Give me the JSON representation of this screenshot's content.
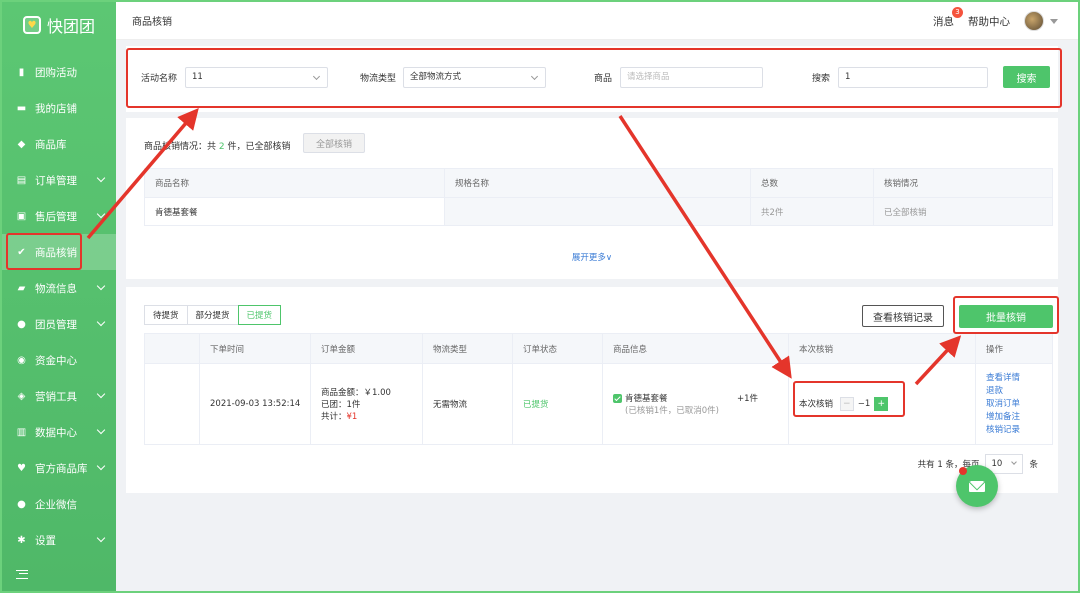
{
  "app": {
    "name": "快团团"
  },
  "sidebar": {
    "items": [
      {
        "label": "团购活动",
        "icon": "bookmark-icon",
        "expandable": false
      },
      {
        "label": "我的店铺",
        "icon": "store-icon",
        "expandable": false
      },
      {
        "label": "商品库",
        "icon": "box-icon",
        "expandable": false
      },
      {
        "label": "订单管理",
        "icon": "order-icon",
        "expandable": true
      },
      {
        "label": "售后管理",
        "icon": "aftersale-icon",
        "expandable": true
      },
      {
        "label": "商品核销",
        "icon": "bag-check-icon",
        "expandable": false,
        "active": true
      },
      {
        "label": "物流信息",
        "icon": "truck-icon",
        "expandable": true
      },
      {
        "label": "团员管理",
        "icon": "user-icon",
        "expandable": true
      },
      {
        "label": "资金中心",
        "icon": "money-icon",
        "expandable": false
      },
      {
        "label": "营销工具",
        "icon": "tag-icon",
        "expandable": true
      },
      {
        "label": "数据中心",
        "icon": "chart-icon",
        "expandable": true
      },
      {
        "label": "官方商品库",
        "icon": "heart-icon",
        "expandable": true
      },
      {
        "label": "企业微信",
        "icon": "wechat-icon",
        "expandable": false
      },
      {
        "label": "设置",
        "icon": "gear-icon",
        "expandable": true
      }
    ]
  },
  "topbar": {
    "breadcrumb": "商品核销",
    "messages_label": "消息",
    "messages_count": "3",
    "help_label": "帮助中心"
  },
  "search": {
    "activity_label": "活动名称",
    "activity_value": "11",
    "logistics_label": "物流类型",
    "logistics_value": "全部物流方式",
    "product_label": "商品",
    "product_placeholder": "请选择商品",
    "keyword_label": "搜索",
    "keyword_value": "1",
    "search_button": "搜索"
  },
  "summary": {
    "text_prefix": "商品核销情况：共",
    "count": "2",
    "text_suffix": "件，已全部核销",
    "all_button": "全部核销",
    "columns": [
      "商品名称",
      "规格名称",
      "总数",
      "核销情况"
    ],
    "rows": [
      {
        "name": "肯德基套餐",
        "spec": "",
        "total": "共2件",
        "status": "已全部核销"
      }
    ],
    "expand_label": "展开更多∨"
  },
  "orders": {
    "tabs": [
      {
        "label": "待提货",
        "active": false
      },
      {
        "label": "部分提货",
        "active": false
      },
      {
        "label": "已提货",
        "active": true
      }
    ],
    "records_button": "查看核销记录",
    "batch_button": "批量核销",
    "columns": [
      "",
      "下单时间",
      "订单金额",
      "物流类型",
      "订单状态",
      "商品信息",
      "本次核销",
      "操作"
    ],
    "row": {
      "time": "2021-09-03 13:52:14",
      "amount_line1": "商品金额：￥1.00",
      "amount_line2": "已团：1件",
      "amount_total_label": "共计：",
      "amount_total_value": "¥1",
      "logistics": "无需物流",
      "status": "已提货",
      "product_name": "肯德基套餐",
      "product_sub": "(已核销1件，已取消0件)",
      "product_qty": "+1件",
      "verify_label": "本次核销",
      "verify_minus": "−",
      "verify_value": "−1",
      "verify_plus": "+",
      "actions": [
        "查看详情",
        "退款",
        "取消订单",
        "增加备注",
        "核销记录"
      ]
    },
    "pager": {
      "total_text": "共有 1 条，每页",
      "page_size": "10",
      "unit": "条"
    }
  },
  "colors": {
    "accent": "#4ec56b",
    "highlight": "#e4352b",
    "link": "#3a7bd5"
  }
}
